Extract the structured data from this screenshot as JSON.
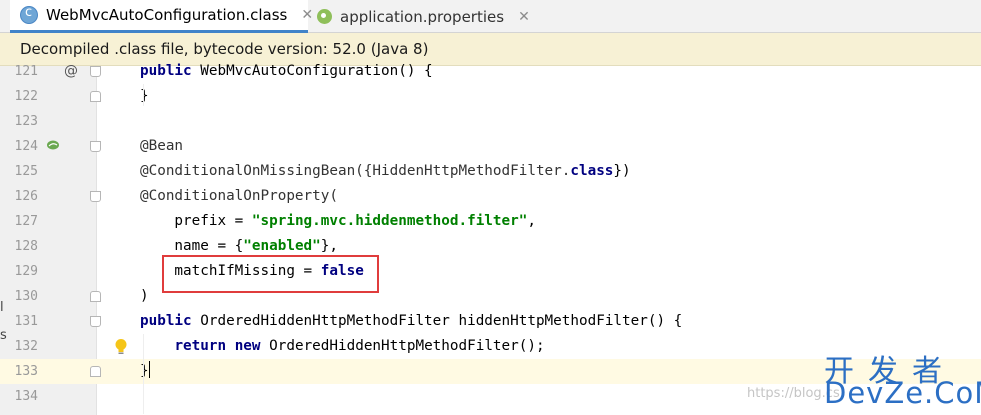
{
  "tabs": [
    {
      "label": "WebMvcAutoConfiguration.class",
      "icon": "class-file-icon",
      "active": true,
      "close": "✕"
    },
    {
      "label": "application.properties",
      "icon": "properties-file-icon",
      "active": false,
      "close": "✕"
    }
  ],
  "notice": "Decompiled .class file, bytecode version: 52.0 (Java 8)",
  "editor": {
    "current_line": "133",
    "lines": [
      {
        "num": "121",
        "parts": [
          {
            "t": "public",
            "c": "kw"
          },
          {
            "t": " WebMvcAutoConfiguration() {",
            "c": ""
          }
        ]
      },
      {
        "num": "122",
        "parts": [
          {
            "t": "}",
            "c": ""
          }
        ]
      },
      {
        "num": "123",
        "parts": []
      },
      {
        "num": "124",
        "parts": [
          {
            "t": "@Bean",
            "c": "ann"
          }
        ]
      },
      {
        "num": "125",
        "parts": [
          {
            "t": "@ConditionalOnMissingBean({HiddenHttpMethodFilter.",
            "c": "ann"
          },
          {
            "t": "class",
            "c": "kw"
          },
          {
            "t": "})",
            "c": ""
          }
        ]
      },
      {
        "num": "126",
        "parts": [
          {
            "t": "@ConditionalOnProperty(",
            "c": "ann"
          }
        ]
      },
      {
        "num": "127",
        "parts": [
          {
            "t": "    prefix = ",
            "c": ""
          },
          {
            "t": "\"spring.mvc.hiddenmethod.filter\"",
            "c": "str"
          },
          {
            "t": ",",
            "c": ""
          }
        ]
      },
      {
        "num": "128",
        "parts": [
          {
            "t": "    name = {",
            "c": ""
          },
          {
            "t": "\"enabled\"",
            "c": "str"
          },
          {
            "t": "},",
            "c": ""
          }
        ]
      },
      {
        "num": "129",
        "parts": [
          {
            "t": "    matchIfMissing = ",
            "c": ""
          },
          {
            "t": "false",
            "c": "kw"
          }
        ]
      },
      {
        "num": "130",
        "parts": [
          {
            "t": ")",
            "c": ""
          }
        ]
      },
      {
        "num": "131",
        "parts": [
          {
            "t": "public",
            "c": "kw"
          },
          {
            "t": " OrderedHiddenHttpMethodFilter hiddenHttpMethodFilter() {",
            "c": ""
          }
        ]
      },
      {
        "num": "132",
        "parts": [
          {
            "t": "    ",
            "c": ""
          },
          {
            "t": "return",
            "c": "kw"
          },
          {
            "t": " ",
            "c": ""
          },
          {
            "t": "new",
            "c": "kw"
          },
          {
            "t": " OrderedHiddenHttpMethodFilter();",
            "c": ""
          }
        ]
      },
      {
        "num": "133",
        "parts": [
          {
            "t": "}",
            "c": ""
          }
        ]
      },
      {
        "num": "134",
        "parts": []
      }
    ],
    "gutter_marks": {
      "at_symbol": "@"
    }
  },
  "watermark": {
    "url": "https://blog.cs",
    "brand_cn": "开发者",
    "brand_en": "DevZe.CoM"
  },
  "edge_glyphs": [
    "l",
    "s"
  ],
  "colors": {
    "keyword": "#000080",
    "string": "#008000",
    "highlight_box": "#e03c3c",
    "current_line": "#fffae3",
    "notice_bg": "#f7f1d5",
    "tab_underline": "#4083c9",
    "watermark_brand": "#2c6fc4"
  }
}
